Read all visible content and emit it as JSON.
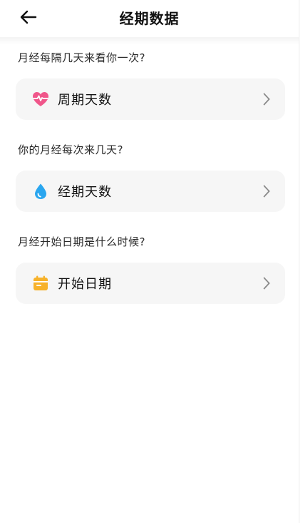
{
  "header": {
    "title": "经期数据"
  },
  "sections": [
    {
      "question": "月经每隔几天来看你一次?",
      "item_label": "周期天数",
      "icon": "heart-pulse-icon"
    },
    {
      "question": "你的月经每次来几天?",
      "item_label": "经期天数",
      "icon": "water-drop-icon"
    },
    {
      "question": "月经开始日期是什么时候?",
      "item_label": "开始日期",
      "icon": "calendar-icon"
    }
  ],
  "colors": {
    "heart": "#f0568a",
    "drop": "#2aa6ef",
    "calendar": "#f7b22a",
    "card_bg": "#f6f6f6"
  }
}
